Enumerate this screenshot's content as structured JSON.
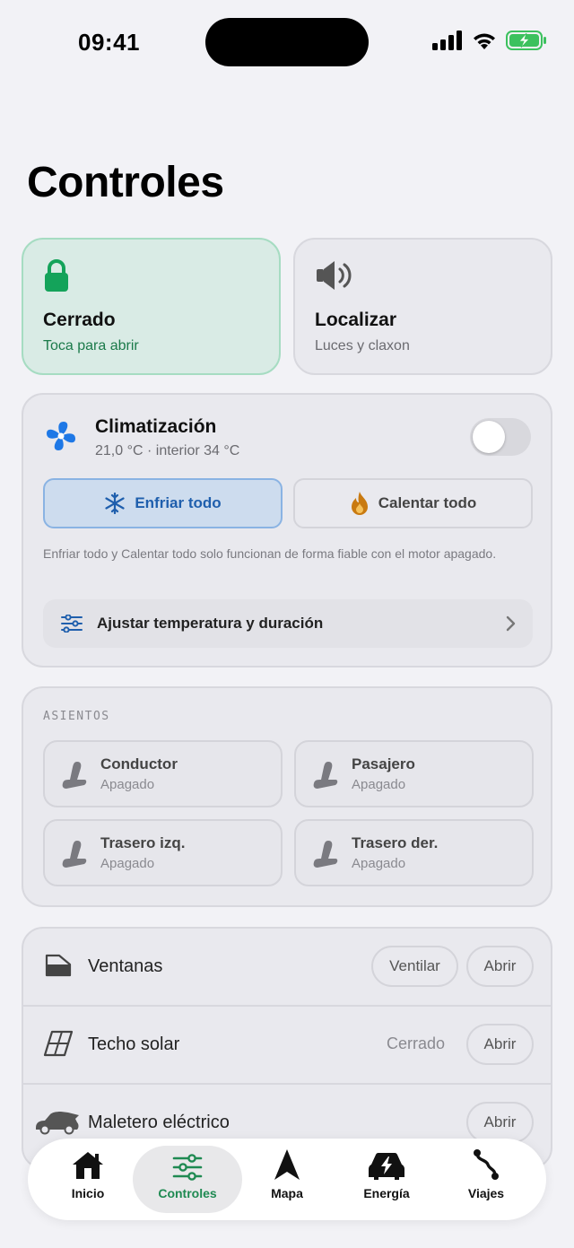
{
  "status_bar": {
    "time": "09:41"
  },
  "page": {
    "title": "Controles"
  },
  "lock": {
    "title": "Cerrado",
    "subtitle": "Toca para abrir"
  },
  "locate": {
    "title": "Localizar",
    "subtitle": "Luces y claxon"
  },
  "climate": {
    "title": "Climatización",
    "subtitle": "21,0 °C · interior 34 °C",
    "enabled": false,
    "cool_label": "Enfriar todo",
    "heat_label": "Calentar todo",
    "note": "Enfriar todo y Calentar todo solo funcionan de forma fiable con el motor apagado.",
    "adjust_label": "Ajustar temperatura y duración"
  },
  "seats": {
    "section_label": "ASIENTOS",
    "items": [
      {
        "name": "Conductor",
        "state": "Apagado"
      },
      {
        "name": "Pasajero",
        "state": "Apagado"
      },
      {
        "name": "Trasero izq.",
        "state": "Apagado"
      },
      {
        "name": "Trasero der.",
        "state": "Apagado"
      }
    ]
  },
  "access": {
    "windows": {
      "label": "Ventanas",
      "vent_label": "Ventilar",
      "open_label": "Abrir"
    },
    "sunroof": {
      "label": "Techo solar",
      "status": "Cerrado",
      "open_label": "Abrir"
    },
    "trunk": {
      "label": "Maletero eléctrico",
      "open_label": "Abrir"
    }
  },
  "tabs": [
    {
      "label": "Inicio",
      "icon": "home-icon"
    },
    {
      "label": "Controles",
      "icon": "sliders-icon",
      "active": true
    },
    {
      "label": "Mapa",
      "icon": "navigation-arrow-icon"
    },
    {
      "label": "Energía",
      "icon": "car-charging-icon"
    },
    {
      "label": "Viajes",
      "icon": "route-icon"
    }
  ],
  "colors": {
    "accent_green": "#1f8a52",
    "lock_green": "#14a35a",
    "cool_blue": "#1f5fad",
    "fan_blue": "#1e78e6",
    "heat_orange": "#c97a10"
  }
}
